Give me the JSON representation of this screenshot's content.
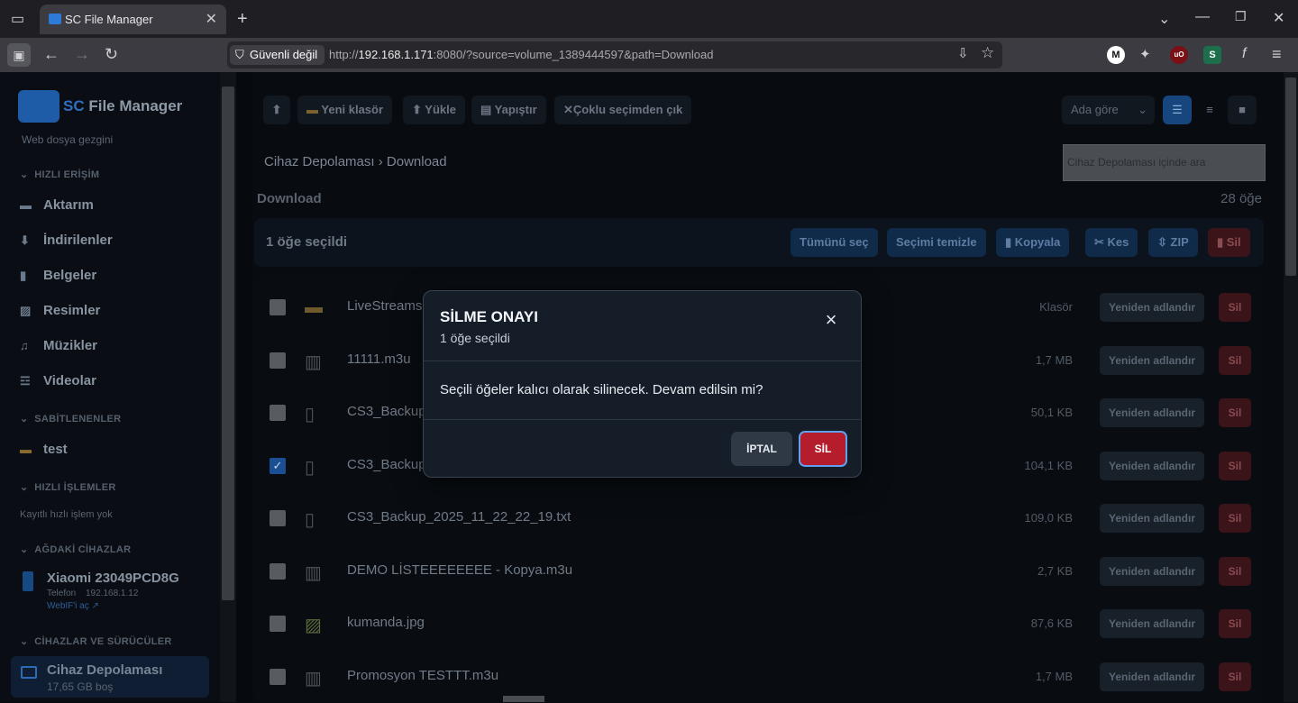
{
  "browser": {
    "tab_title": "SC File Manager",
    "security_label": "Güvenli değil",
    "url_prefix": "http://",
    "url_host": "192.168.1.171",
    "url_rest": ":8080/?source=volume_1389444597&path=Download"
  },
  "sidebar": {
    "app_name_a": "SC",
    "app_name_b": " File Manager",
    "subtitle": "Web dosya gezgini",
    "quick_access_title": "HIZLI ERİŞİM",
    "quick_access": [
      {
        "label": "Aktarım",
        "icon": "transfer-icon"
      },
      {
        "label": "İndirilenler",
        "icon": "download-icon"
      },
      {
        "label": "Belgeler",
        "icon": "document-icon"
      },
      {
        "label": "Resimler",
        "icon": "image-icon"
      },
      {
        "label": "Müzikler",
        "icon": "music-icon"
      },
      {
        "label": "Videolar",
        "icon": "video-icon"
      }
    ],
    "pinned_title": "SABİTLENENLER",
    "pinned": [
      {
        "label": "test",
        "icon": "folder-icon"
      }
    ],
    "quick_ops_title": "HIZLI İŞLEMLER",
    "quick_ops_empty": "Kayıtlı hızlı işlem yok",
    "network_title": "AĞDAKİ CİHAZLAR",
    "device_name": "Xiaomi 23049PCD8G",
    "device_type": "Telefon",
    "device_ip": "192.168.1.12",
    "device_link": "WebIF'i aç ↗",
    "drives_title": "CİHAZLAR VE SÜRÜCÜLER",
    "drive_name": "Cihaz Depolaması",
    "drive_free": "17,65 GB boş"
  },
  "toolbar": {
    "up": "⬆",
    "new_folder": "Yeni klasör",
    "upload": "Yükle",
    "paste": "Yapıştır",
    "exit_multi": "Çoklu seçimden çık",
    "sort": "Ada göre"
  },
  "breadcrumb": {
    "root": "Cihaz Depolaması",
    "sep": "›",
    "current": "Download"
  },
  "search_placeholder": "Cihaz Depolaması içinde ara",
  "folder_title": "Download",
  "item_count": "28 öğe",
  "selection": {
    "count": "1 öğe seçildi",
    "select_all": "Tümünü seç",
    "clear": "Seçimi temizle",
    "copy": "Kopyala",
    "cut": "Kes",
    "zip": "ZIP",
    "delete": "Sil"
  },
  "files": [
    {
      "name": "LiveStreams",
      "size": "Klasör",
      "icon": "folder-icon",
      "checked": false
    },
    {
      "name": "11111.m3u",
      "size": "1,7 MB",
      "icon": "radio-icon",
      "checked": false
    },
    {
      "name": "CS3_Backup",
      "size": "50,1 KB",
      "icon": "file-icon",
      "checked": false
    },
    {
      "name": "CS3_Backup",
      "size": "104,1 KB",
      "icon": "file-icon",
      "checked": true
    },
    {
      "name": "CS3_Backup_2025_11_22_22_19.txt",
      "size": "109,0 KB",
      "icon": "file-icon",
      "checked": false
    },
    {
      "name": "DEMO LİSTEEEEEEEE - Kopya.m3u",
      "size": "2,7 KB",
      "icon": "radio-icon",
      "checked": false
    },
    {
      "name": "kumanda.jpg",
      "size": "87,6 KB",
      "icon": "image-icon",
      "checked": false
    },
    {
      "name": "Promosyon TESTTT.m3u",
      "size": "1,7 MB",
      "icon": "radio-icon",
      "checked": false
    }
  ],
  "row_actions": {
    "rename": "Yeniden adlandır",
    "delete": "Sil"
  },
  "modal": {
    "title": "SİLME ONAYI",
    "subtitle": "1 öğe seçildi",
    "message": "Seçili öğeler kalıcı olarak silinecek. Devam edilsin mi?",
    "cancel": "İPTAL",
    "confirm": "SİL"
  },
  "colors": {
    "accent": "#1e5ca8",
    "danger": "#b51d2c"
  }
}
